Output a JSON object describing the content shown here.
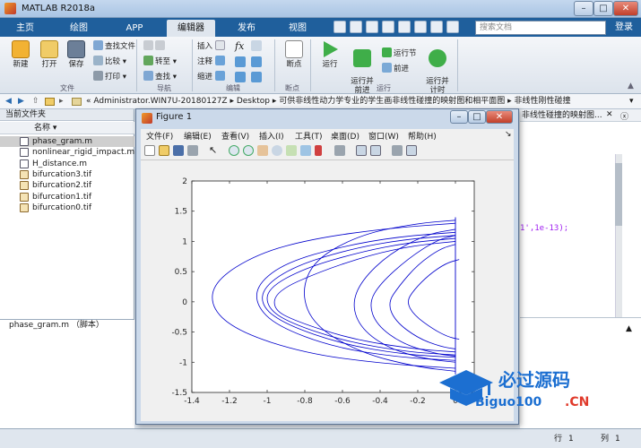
{
  "window": {
    "title": "MATLAB R2018a"
  },
  "tabs": [
    "主页",
    "绘图",
    "APP",
    "编辑器",
    "发布",
    "视图"
  ],
  "active_tab": "编辑器",
  "search": {
    "placeholder": "搜索文档"
  },
  "login_label": "登录",
  "ribbon": {
    "new": "新建",
    "open": "打开",
    "save": "保存",
    "find_files": "查找文件",
    "compare": "比较",
    "print": "打印",
    "goto": "转至",
    "find": "查找",
    "insert": "插入",
    "comment": "注释",
    "indent": "缩进",
    "breakpoints": "断点",
    "run": "运行",
    "run_advance": "运行并\n前进",
    "run_section": "运行节",
    "advance": "前进",
    "run_time": "运行并\n计时",
    "groups": {
      "file": "文件",
      "nav": "导航",
      "edit": "编辑",
      "bp": "断点",
      "run": "运行"
    }
  },
  "address": {
    "path": [
      "Administrator.WIN7U-20180127Z",
      "Desktop",
      "可供非线性动力学专业的学生画非线性碰撞的映射图和相平面图",
      "非线性刚性碰撞"
    ]
  },
  "current_folder": {
    "header": "当前文件夹",
    "column": "名称",
    "files": [
      {
        "name": "phase_gram.m",
        "type": "m",
        "selected": true
      },
      {
        "name": "nonlinear_rigid_impact.m",
        "type": "m"
      },
      {
        "name": "H_distance.m",
        "type": "m"
      },
      {
        "name": "bifurcation3.tif",
        "type": "tif"
      },
      {
        "name": "bifurcation2.tif",
        "type": "tif"
      },
      {
        "name": "bifurcation1.tif",
        "type": "tif"
      },
      {
        "name": "bifurcation0.tif",
        "type": "tif"
      }
    ],
    "detail": "phase_gram.m （脚本）"
  },
  "editor_tab_label": "非线性碰撞的映射图...",
  "code_fragment": "1',1e-13);",
  "figure": {
    "title": "Figure 1",
    "menu": [
      "文件(F)",
      "编辑(E)",
      "查看(V)",
      "插入(I)",
      "工具(T)",
      "桌面(D)",
      "窗口(W)",
      "帮助(H)"
    ]
  },
  "status": {
    "row_label": "行",
    "row": "1",
    "col_label": "列",
    "col": "1"
  },
  "watermark": {
    "text1": "必过源码",
    "text2": "Biguo100",
    "text3": ".CN"
  },
  "chart_data": {
    "type": "line",
    "title": "",
    "xlabel": "",
    "ylabel": "",
    "xlim": [
      -1.4,
      0.1
    ],
    "ylim": [
      -1.5,
      2
    ],
    "xticks": [
      -1.4,
      -1.2,
      -1,
      -0.8,
      -0.6,
      -0.4,
      -0.2,
      0
    ],
    "yticks": [
      -1.5,
      -1,
      -0.5,
      0,
      0.5,
      1,
      1.5,
      2
    ],
    "color": "#0000cc",
    "series": [
      {
        "values_x": [
          0,
          -0.35,
          -0.75,
          -1.05,
          -1.28,
          -1.3,
          -1.15,
          -0.8,
          -0.4,
          0
        ],
        "values_y": [
          1.3,
          1.22,
          1.05,
          0.8,
          0.35,
          -0.1,
          -0.5,
          -0.85,
          -1.02,
          -1.1
        ]
      },
      {
        "values_x": [
          0,
          -0.3,
          -0.6,
          -0.9,
          -1.05,
          -1.06,
          -0.95,
          -0.65,
          -0.3,
          0
        ],
        "values_y": [
          1.15,
          1.08,
          0.92,
          0.65,
          0.3,
          -0.05,
          -0.4,
          -0.75,
          -0.92,
          -0.97
        ]
      },
      {
        "values_x": [
          0,
          -0.28,
          -0.55,
          -0.85,
          -1.02,
          -1.03,
          -0.9,
          -0.6,
          -0.28,
          0
        ],
        "values_y": [
          1.1,
          1.03,
          0.88,
          0.6,
          0.25,
          -0.08,
          -0.38,
          -0.7,
          -0.87,
          -0.92
        ]
      },
      {
        "values_x": [
          0,
          -0.25,
          -0.5,
          -0.8,
          -1.0,
          -1.0,
          -0.88,
          -0.58,
          -0.25,
          0
        ],
        "values_y": [
          1.05,
          0.98,
          0.83,
          0.56,
          0.22,
          -0.1,
          -0.35,
          -0.66,
          -0.83,
          -0.88
        ]
      },
      {
        "values_x": [
          0,
          -0.22,
          -0.45,
          -0.72,
          -0.95,
          -0.97,
          -0.85,
          -0.55,
          -0.22,
          0
        ],
        "values_y": [
          1.0,
          0.93,
          0.78,
          0.5,
          0.18,
          -0.12,
          -0.32,
          -0.62,
          -0.78,
          -0.83
        ]
      },
      {
        "values_x": [
          0,
          -0.15,
          -0.35,
          -0.5,
          -0.55,
          -0.5,
          -0.35,
          -0.15,
          0
        ],
        "values_y": [
          1.2,
          1.12,
          0.8,
          0.35,
          -0.05,
          -0.45,
          -0.78,
          -0.95,
          -1.0
        ]
      },
      {
        "values_x": [
          0,
          -0.1,
          -0.25,
          -0.4,
          -0.46,
          -0.42,
          -0.28,
          -0.1,
          0
        ],
        "values_y": [
          1.1,
          1.02,
          0.72,
          0.3,
          -0.02,
          -0.38,
          -0.7,
          -0.86,
          -0.9
        ]
      },
      {
        "values_x": [
          0,
          -0.08,
          -0.2,
          -0.3,
          -0.36,
          -0.32,
          -0.2,
          -0.08,
          0
        ],
        "values_y": [
          0.95,
          0.88,
          0.62,
          0.26,
          -0.02,
          -0.32,
          -0.6,
          -0.74,
          -0.78
        ]
      },
      {
        "values_x": [
          0.02,
          -0.05,
          -0.14,
          -0.22,
          -0.26,
          -0.22,
          -0.12,
          -0.04,
          0.02
        ],
        "values_y": [
          0.7,
          0.64,
          0.45,
          0.2,
          0.0,
          -0.22,
          -0.45,
          -0.58,
          -0.62
        ]
      },
      {
        "values_x": [
          0,
          -0.2,
          -0.5,
          -0.75,
          -0.82,
          -0.75,
          -0.5,
          -0.2,
          0
        ],
        "values_y": [
          1.35,
          1.3,
          1.12,
          0.7,
          0.15,
          -0.4,
          -0.85,
          -1.08,
          -1.15
        ]
      }
    ]
  }
}
